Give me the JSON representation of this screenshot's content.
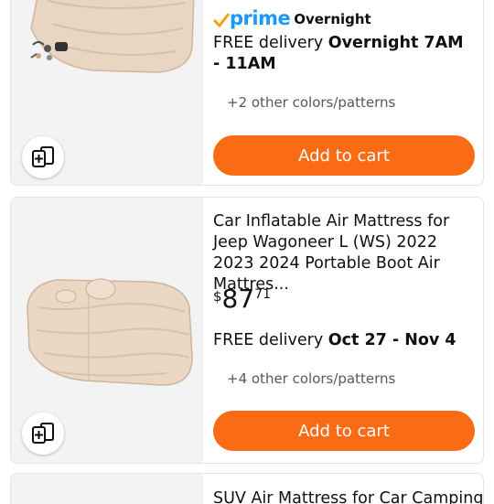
{
  "colors": {
    "cart_button": "#fa6b15",
    "prime_blue": "#1a98ff",
    "prime_check": "#f7a20a",
    "card_border": "#e3e6e6",
    "image_bg": "#f3f3f3"
  },
  "products": [
    {
      "prime_label": "prime",
      "prime_tier": "Overnight",
      "delivery_prefix": "FREE delivery ",
      "delivery_date": "Overnight 7AM - 11AM",
      "other_colors": "+2 other colors/patterns",
      "cart_label": "Add to cart",
      "compare_icon": "compare-icon",
      "image_icon": "inflatable-mattress"
    },
    {
      "title": "Car Inflatable Air Mattress for Jeep Wagoneer L (WS) 2022 2023 2024 Portable Boot Air Mattres...",
      "price_symbol": "$",
      "price_whole": "87",
      "price_fraction": "71",
      "delivery_prefix": "FREE delivery ",
      "delivery_date": "Oct 27 - Nov 4",
      "other_colors": "+4 other colors/patterns",
      "cart_label": "Add to cart",
      "compare_icon": "compare-icon",
      "image_icon": "inflatable-mattress"
    },
    {
      "title": "SUV Air Mattress for Car Camping",
      "image_icon": "inflatable-mattress"
    }
  ]
}
